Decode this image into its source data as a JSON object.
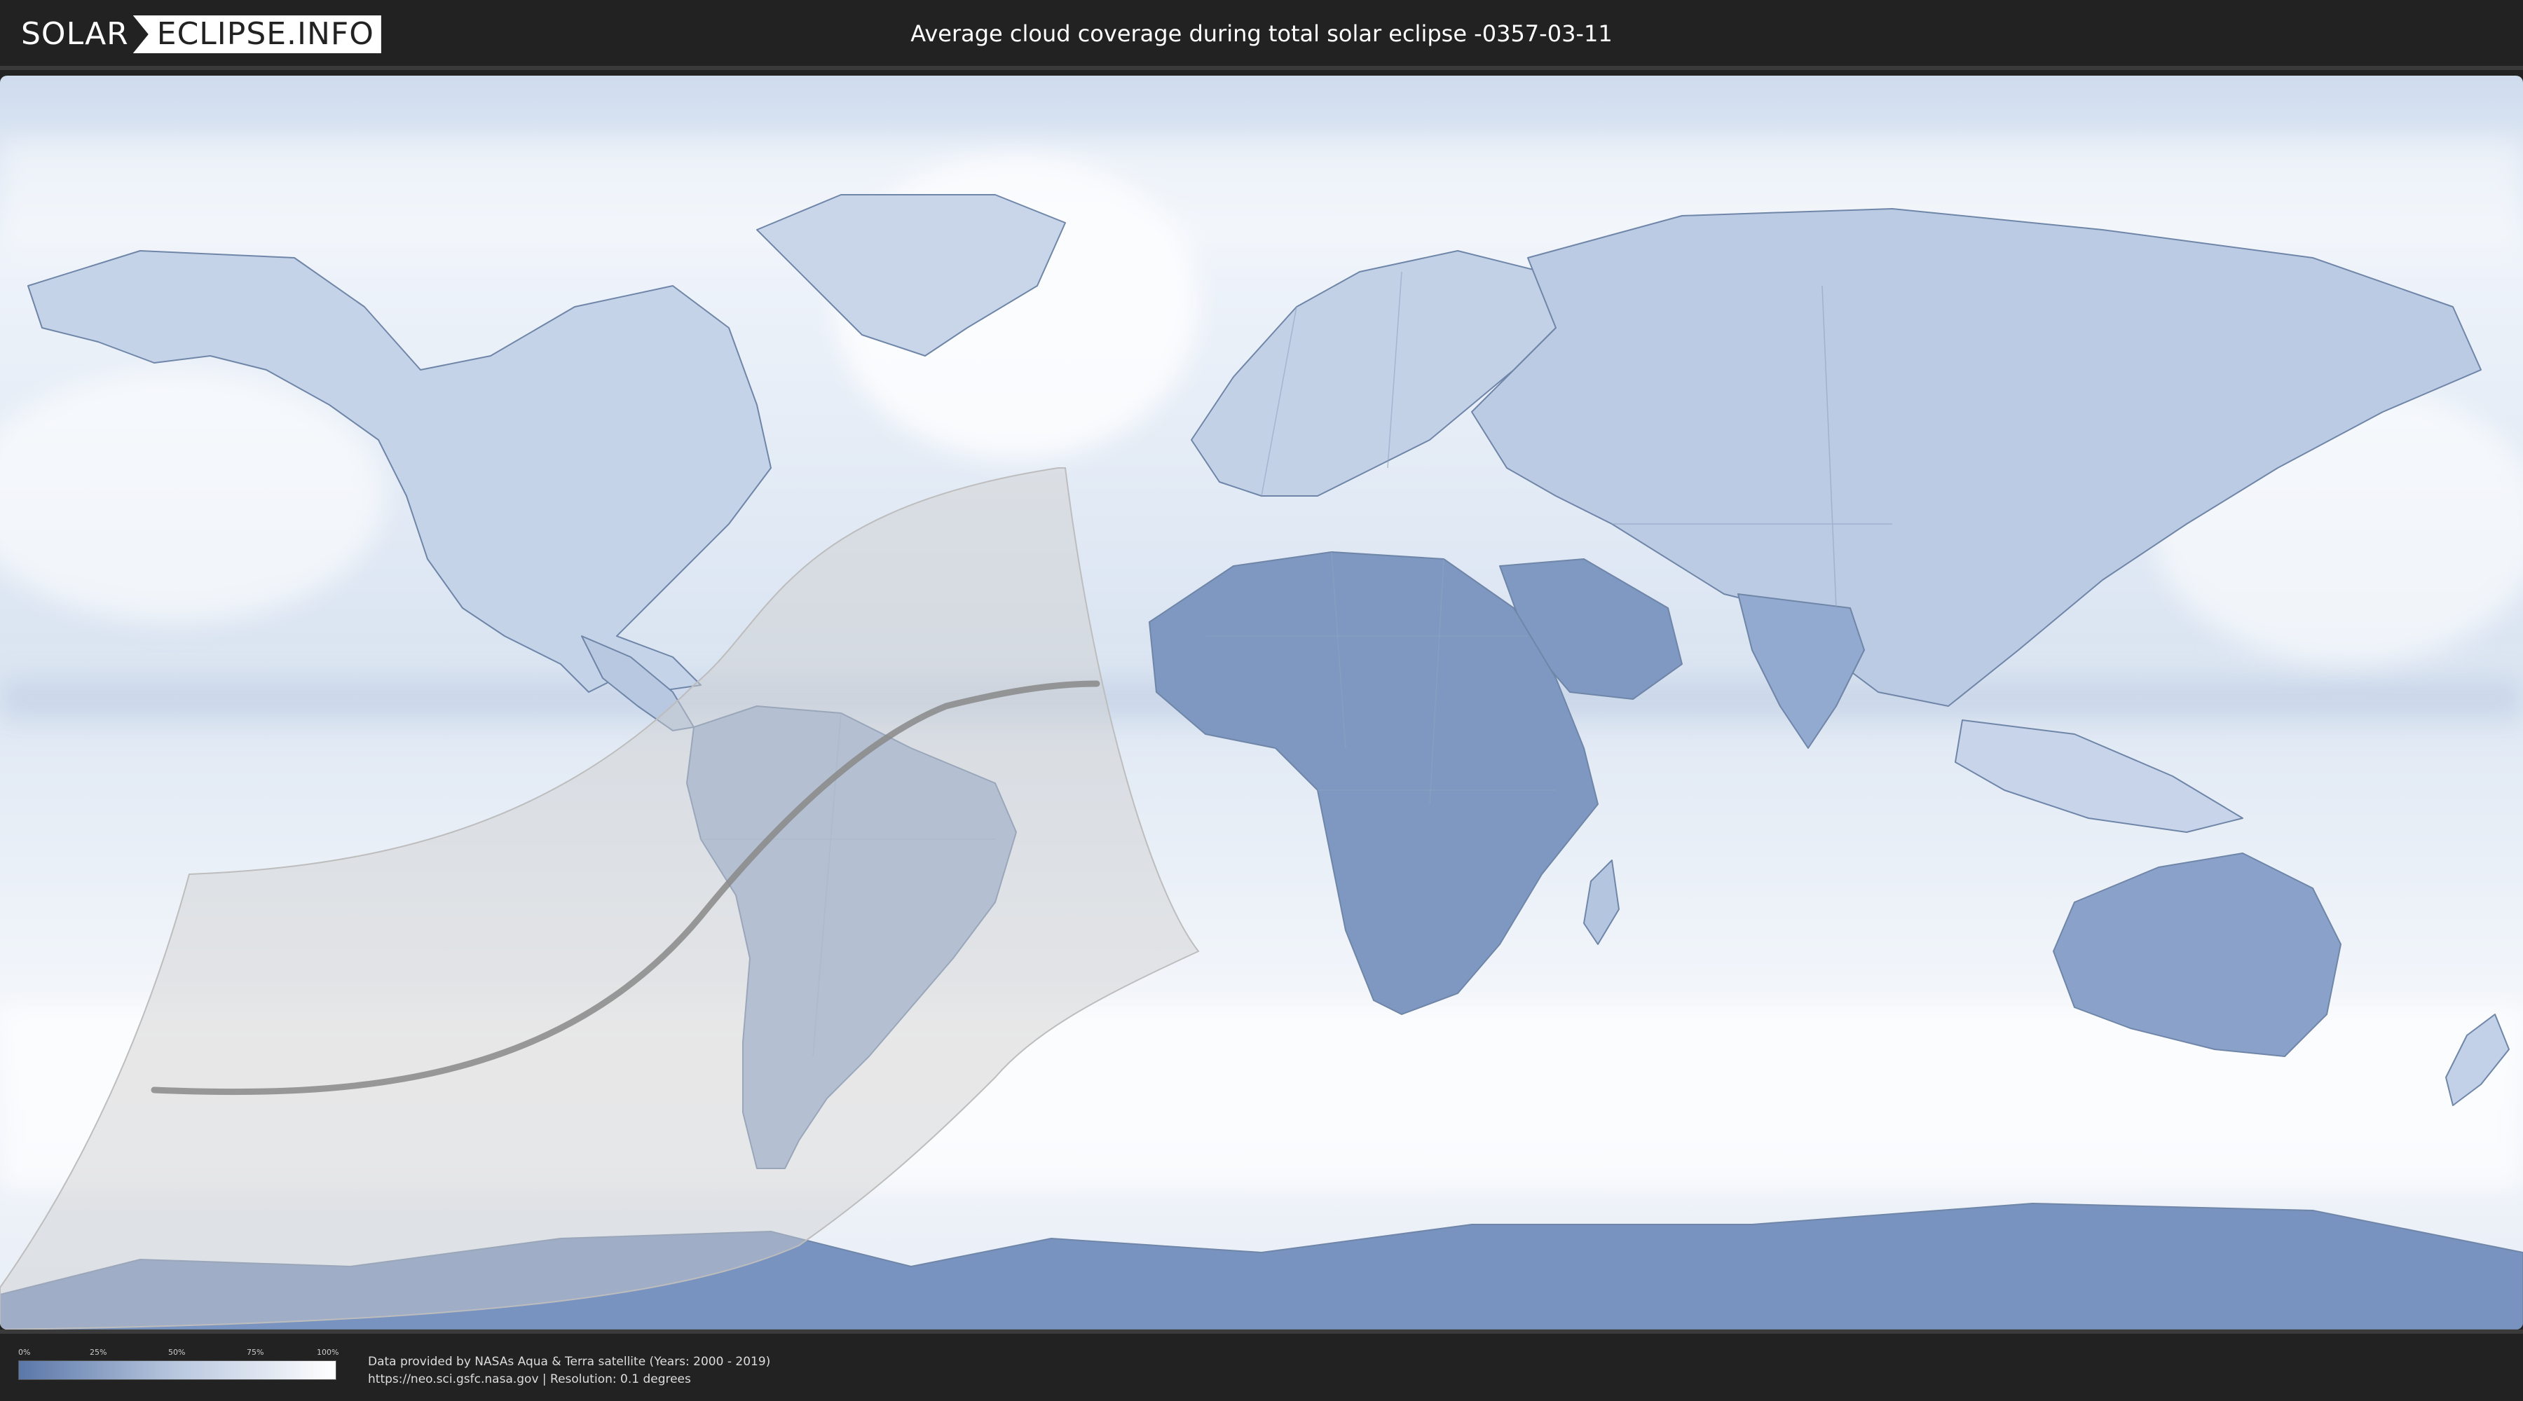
{
  "header": {
    "logo_left": "SOLAR",
    "logo_right": "ECLIPSE.INFO",
    "title": "Average cloud coverage during total solar eclipse -0357-03-11"
  },
  "map": {
    "ocean_color": "#e9eff8",
    "cloud_color": "#ffffff",
    "clear_sky_color": "#5a78a6",
    "land_outline_color": "#6f86a8",
    "visibility_zone_color": "#cfcfcf",
    "totality_path_color": "#8a8a8a"
  },
  "legend": {
    "ticks": [
      "0%",
      "25%",
      "50%",
      "75%",
      "100%"
    ],
    "color_low": "#5a77a8",
    "color_mid": "#b9c8df",
    "color_high": "#ffffff"
  },
  "footer": {
    "credit_line": "Data provided by NASAs Aqua & Terra satellite (Years: 2000 - 2019)",
    "source_line": "https://neo.sci.gsfc.nasa.gov | Resolution: 0.1 degrees"
  }
}
